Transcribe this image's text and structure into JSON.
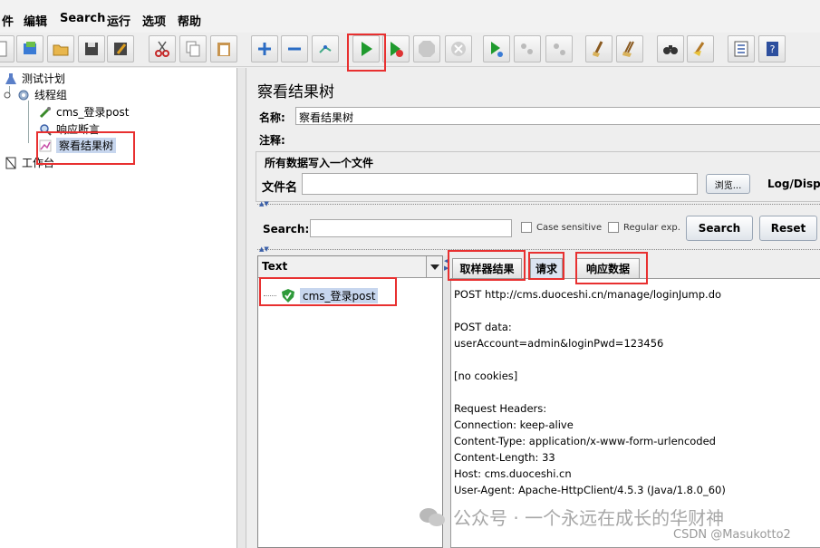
{
  "menu": {
    "items": [
      "件",
      "编辑",
      "Search",
      "运行",
      "选项",
      "帮助"
    ]
  },
  "tree": {
    "nodes": {
      "test_plan": "测试计划",
      "thread_group": "线程组",
      "sampler": "cms_登录post",
      "assertion": "响应断言",
      "listener": "察看结果树",
      "workbench": "工作台"
    }
  },
  "panel": {
    "title": "察看结果树",
    "name_label": "名称:",
    "name_value": "察看结果树",
    "comment_label": "注释:",
    "write_all_label": "所有数据写入一个文件",
    "filename_label": "文件名",
    "browse_button": "浏览...",
    "log_display": "Log/Displa"
  },
  "search": {
    "label": "Search:",
    "case_sensitive": "Case sensitive",
    "regular_exp": "Regular exp.",
    "search_button": "Search",
    "reset_button": "Reset"
  },
  "results": {
    "renderer": "Text",
    "items": [
      "cms_登录post"
    ]
  },
  "tabs": [
    "取样器结果",
    "请求",
    "响应数据"
  ],
  "request_lines": [
    "POST http://cms.duoceshi.cn/manage/loginJump.do",
    "",
    "POST data:",
    "userAccount=admin&loginPwd=123456",
    "",
    "[no cookies]",
    "",
    "Request Headers:",
    "Connection: keep-alive",
    "Content-Type: application/x-www-form-urlencoded",
    "Content-Length: 33",
    "Host: cms.duoceshi.cn",
    "User-Agent: Apache-HttpClient/4.5.3 (Java/1.8.0_60)"
  ],
  "watermark": {
    "text": "公众号 · 一个永远在成长的华财神",
    "csdn": "CSDN @Masukotto2"
  },
  "colors": {
    "highlight": "#e83030",
    "run_green": "#1f9a2d",
    "selection": "#c7d6ee"
  }
}
